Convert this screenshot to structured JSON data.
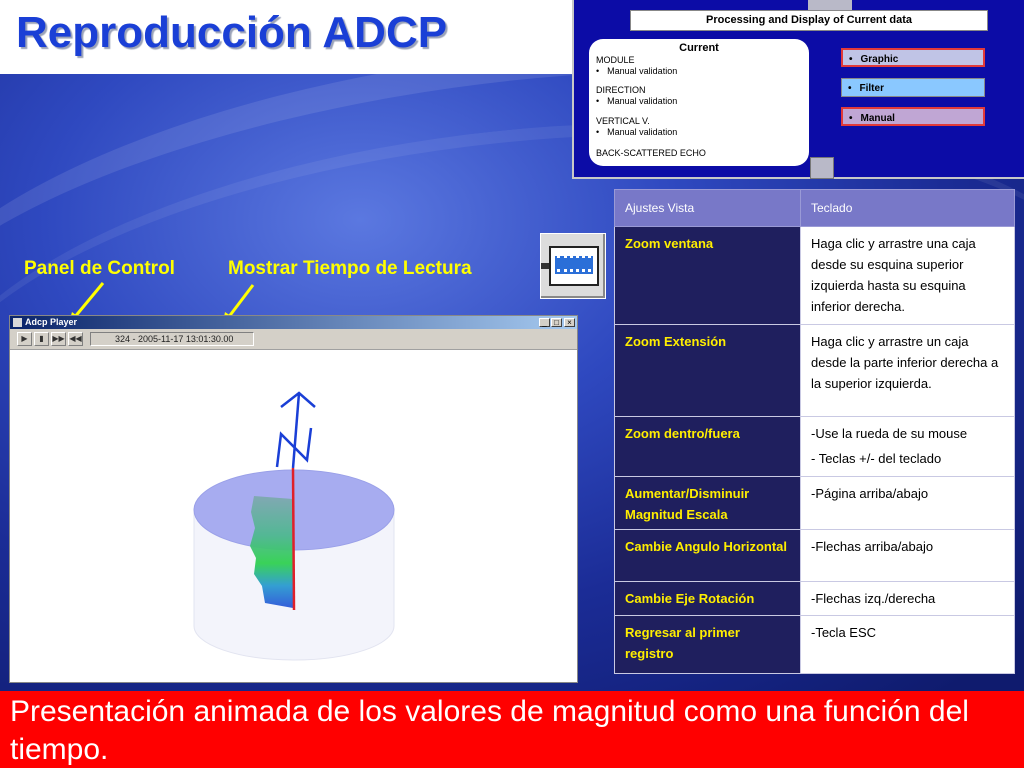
{
  "slide": {
    "title": "Reproducción ADCP"
  },
  "top_panel": {
    "header": "Processing and Display of Current data",
    "card": {
      "title": "Current",
      "module_label": "MODULE",
      "module_item": "Manual validation",
      "direction_label": "DIRECTION",
      "direction_item": "Manual validation",
      "vertical_label": "VERTICAL V.",
      "vertical_item": "Manual validation",
      "backscatter_label": "BACK-SCATTERED ECHO"
    },
    "buttons": [
      "Graphic",
      "Filter",
      "Manual"
    ]
  },
  "labels": {
    "panel_control": "Panel de Control",
    "show_time": "Mostrar Tiempo de Lectura"
  },
  "player": {
    "title": "Adcp Player",
    "readout": "324 - 2005-11-17 13:01:30.00",
    "window_buttons": [
      "_",
      "□",
      "×"
    ],
    "controls": [
      "▶",
      "▮",
      "▶▶",
      "◀◀"
    ]
  },
  "table": {
    "headers": [
      "Ajustes Vista",
      "Teclado"
    ],
    "rows": [
      {
        "key": "Zoom ventana",
        "val": [
          "Haga clic y arrastre una caja desde su esquina superior izquierda hasta su esquina inferior derecha."
        ]
      },
      {
        "key": "Zoom Extensión",
        "val": [
          "Haga clic y arrastre un caja desde la parte inferior derecha a la superior izquierda."
        ]
      },
      {
        "key": "Zoom dentro/fuera",
        "val": [
          "-Use la rueda de su mouse",
          "- Teclas +/- del teclado"
        ]
      },
      {
        "key": "Aumentar/Disminuir Magnitud Escala",
        "val": [
          "-Página arriba/abajo"
        ]
      },
      {
        "key": "Cambie Angulo Horizontal",
        "val": [
          "-Flechas arriba/abajo"
        ]
      },
      {
        "key": "Cambie Eje Rotación",
        "val": [
          "-Flechas izq./derecha"
        ]
      },
      {
        "key": "Regresar al primer registro",
        "val": [
          "-Tecla ESC"
        ]
      }
    ]
  },
  "caption": "Presentación animada de los valores de magnitud como una función del tiempo.",
  "colors": {
    "title_blue": "#1a3fd6",
    "label_yellow": "#ffff00",
    "caption_red": "#ff0000",
    "table_key_bg": "#1f1f5e",
    "table_header_bg": "#7878c8"
  },
  "icons": [
    "film-strip-icon",
    "north-arrow-icon"
  ]
}
